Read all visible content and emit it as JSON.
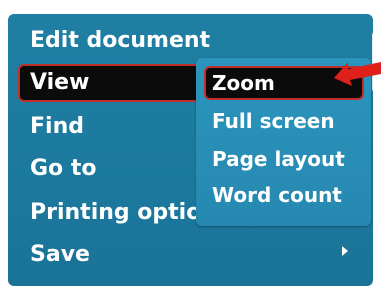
{
  "menu": {
    "items": [
      {
        "label": "Edit document"
      },
      {
        "label": "View"
      },
      {
        "label": "Find"
      },
      {
        "label": "Go to"
      },
      {
        "label": "Printing options"
      },
      {
        "label": "Save"
      }
    ],
    "selected_index": 1,
    "save_has_submenu": true
  },
  "submenu": {
    "items": [
      {
        "label": "Zoom"
      },
      {
        "label": "Full screen"
      },
      {
        "label": "Page layout"
      },
      {
        "label": "Word count"
      }
    ],
    "selected_index": 0
  },
  "icons": {
    "submenu_indicator": "chevron-right-icon",
    "annotation": "red-pointer-arrow-icon"
  },
  "colors": {
    "menu_background": "#1d7a9f",
    "submenu_background": "#2891b9",
    "highlight_fill": "#0b0b0b",
    "highlight_border": "#c0302b",
    "text": "#ffffff",
    "pointer_arrow": "#e0201b"
  }
}
